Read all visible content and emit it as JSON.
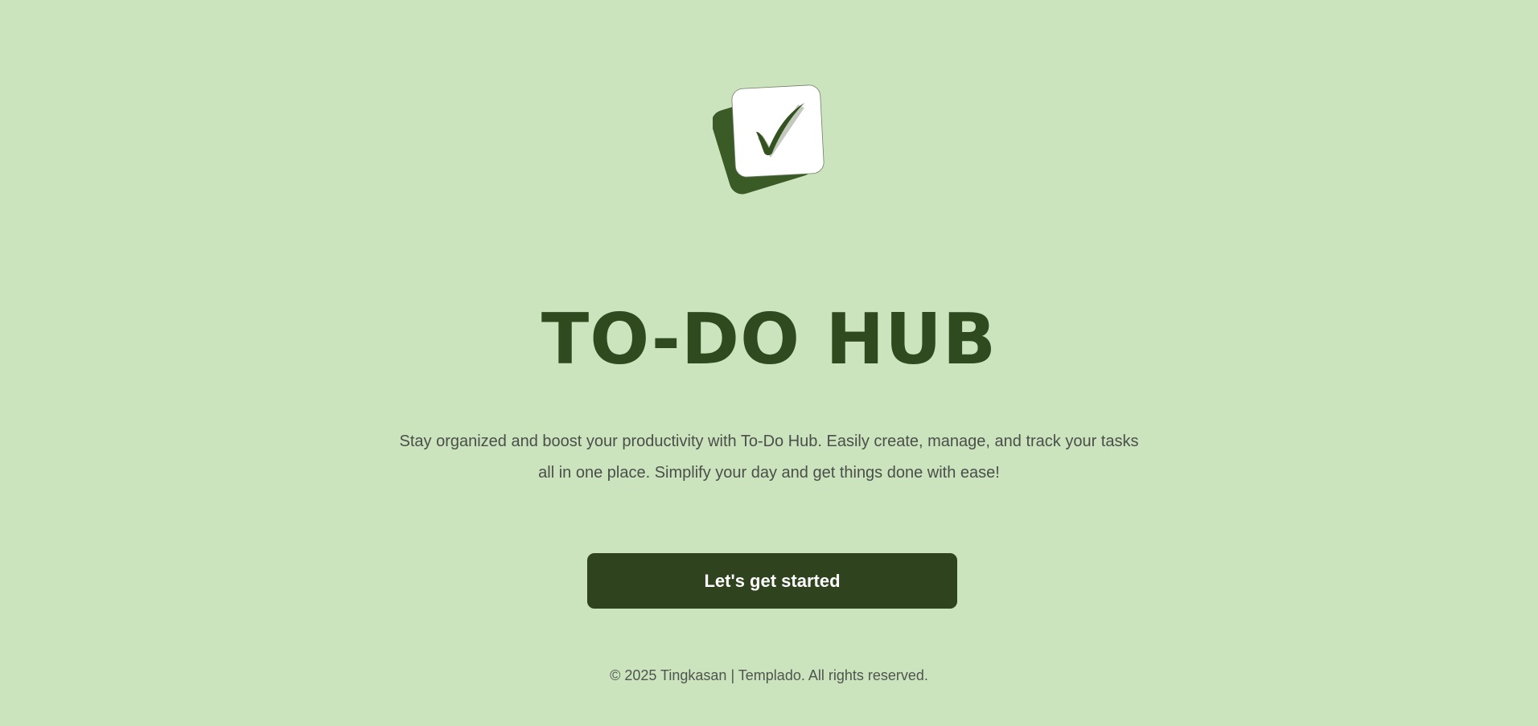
{
  "app": {
    "title": "TO-DO HUB",
    "logo_icon": "checkbox-checkmark-icon",
    "description": "Stay organized and boost your productivity with To-Do Hub. Easily create, manage, and track your tasks all in one place. Simplify your day and get things done with ease!",
    "cta_label": "Let's get started",
    "footer": "© 2025 Tingkasan | Templado. All rights reserved."
  },
  "colors": {
    "background": "#cce4bd",
    "primary_dark_green": "#2f441e",
    "title_green": "#2f4a1e",
    "text_gray": "#4a4f4a",
    "card_white": "#ffffff"
  }
}
